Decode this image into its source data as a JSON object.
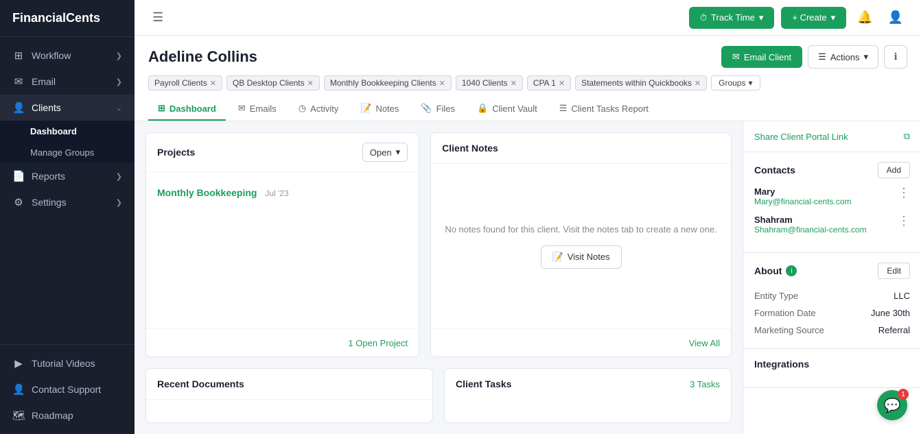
{
  "app": {
    "logo": "FinancialCents"
  },
  "sidebar": {
    "items": [
      {
        "id": "workflow",
        "label": "Workflow",
        "icon": "⊞",
        "hasChevron": true,
        "active": false
      },
      {
        "id": "email",
        "label": "Email",
        "icon": "✉",
        "hasChevron": true,
        "active": false
      },
      {
        "id": "clients",
        "label": "Clients",
        "icon": "👤",
        "hasChevron": true,
        "active": true
      },
      {
        "id": "reports",
        "label": "Reports",
        "icon": "📄",
        "hasChevron": true,
        "active": false
      },
      {
        "id": "settings",
        "label": "Settings",
        "icon": "⚙",
        "hasChevron": true,
        "active": false
      }
    ],
    "clients_sub": [
      {
        "id": "dashboard",
        "label": "Dashboard",
        "active": true
      },
      {
        "id": "manage-groups",
        "label": "Manage Groups",
        "active": false
      }
    ],
    "bottom_items": [
      {
        "id": "tutorial-videos",
        "label": "Tutorial Videos",
        "icon": "▶"
      },
      {
        "id": "contact-support",
        "label": "Contact Support",
        "icon": "👤"
      },
      {
        "id": "roadmap",
        "label": "Roadmap",
        "icon": "🗺"
      }
    ]
  },
  "topbar": {
    "track_time_label": "Track Time",
    "create_label": "+ Create",
    "menu_icon": "☰"
  },
  "client": {
    "name": "Adeline Collins",
    "email_client_label": "Email Client",
    "actions_label": "Actions",
    "tags": [
      "Payroll Clients",
      "QB Desktop Clients",
      "Monthly Bookkeeping Clients",
      "1040 Clients",
      "CPA 1",
      "Statements within Quickbooks"
    ],
    "groups_label": "Groups"
  },
  "tabs": [
    {
      "id": "dashboard",
      "label": "Dashboard",
      "icon": "⊞",
      "active": true
    },
    {
      "id": "emails",
      "label": "Emails",
      "icon": "✉",
      "active": false
    },
    {
      "id": "activity",
      "label": "Activity",
      "icon": "◷",
      "active": false
    },
    {
      "id": "notes",
      "label": "Notes",
      "icon": "📝",
      "active": false
    },
    {
      "id": "files",
      "label": "Files",
      "icon": "📎",
      "active": false
    },
    {
      "id": "client-vault",
      "label": "Client Vault",
      "icon": "🔒",
      "active": false
    },
    {
      "id": "client-tasks-report",
      "label": "Client Tasks Report",
      "icon": "☰",
      "active": false
    }
  ],
  "projects_panel": {
    "title": "Projects",
    "open_label": "Open",
    "projects": [
      {
        "name": "Monthly Bookkeeping",
        "date": "Jul '23"
      }
    ],
    "footer": "1 Open Project"
  },
  "notes_panel": {
    "title": "Client Notes",
    "empty_message": "No notes found for this client. Visit the notes tab to create a new one.",
    "visit_notes_label": "Visit Notes",
    "footer": "View All"
  },
  "documents_panel": {
    "title": "Recent Documents"
  },
  "tasks_panel": {
    "title": "Client Tasks",
    "count": "3 Tasks"
  },
  "right_sidebar": {
    "portal_link_label": "Share Client Portal Link",
    "contacts_title": "Contacts",
    "add_label": "Add",
    "contacts": [
      {
        "name": "Mary",
        "email": "Mary@financial-cents.com"
      },
      {
        "name": "Shahram",
        "email": "Shahram@financial-cents.com"
      }
    ],
    "about_title": "About",
    "edit_label": "Edit",
    "about_fields": [
      {
        "label": "Entity Type",
        "value": "LLC"
      },
      {
        "label": "Formation Date",
        "value": "June 30th"
      },
      {
        "label": "Marketing Source",
        "value": "Referral"
      }
    ],
    "integrations_title": "Integrations"
  },
  "chat": {
    "badge": "1"
  }
}
